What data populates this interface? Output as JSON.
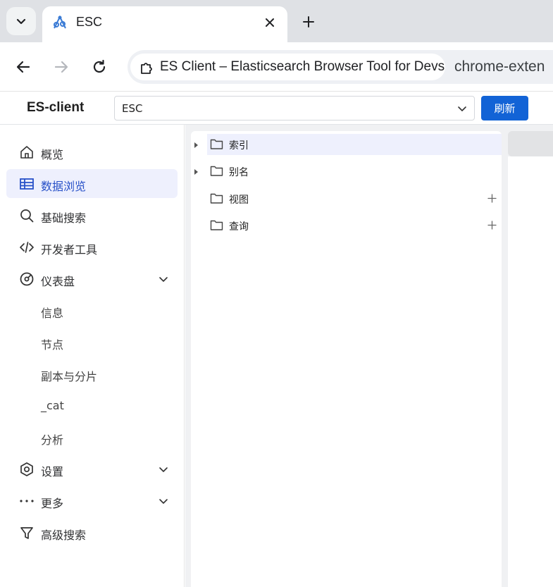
{
  "browser": {
    "tab": {
      "title": "ESC"
    },
    "omnibox": {
      "site_chip_text": "ES Client – Elasticsearch Browser Tool for Devs",
      "url_text": "chrome-exten"
    },
    "icons": {
      "tab_search": "chevron-down-icon",
      "favicon": "esc-logo-icon",
      "tab_close": "close-icon",
      "new_tab": "plus-icon",
      "back": "arrow-left-icon",
      "forward": "arrow-right-icon",
      "reload": "reload-icon",
      "extension": "puzzle-icon"
    }
  },
  "header": {
    "brand": "ES-client",
    "cluster_select": {
      "value": "ESC"
    },
    "refresh_label": "刷新",
    "accent_color": "#1263d6"
  },
  "sidebar": {
    "items": [
      {
        "label": "概览",
        "icon": "home-icon"
      },
      {
        "label": "数据浏览",
        "icon": "table-icon",
        "active": true
      },
      {
        "label": "基础搜索",
        "icon": "search-icon"
      },
      {
        "label": "开发者工具",
        "icon": "code-icon"
      },
      {
        "label": "仪表盘",
        "icon": "dashboard-icon",
        "expanded": true,
        "children": [
          {
            "label": "信息"
          },
          {
            "label": "节点"
          },
          {
            "label": "副本与分片"
          },
          {
            "label": "_cat"
          },
          {
            "label": "分析"
          }
        ]
      },
      {
        "label": "设置",
        "icon": "settings-hexagon-icon"
      },
      {
        "label": "更多",
        "icon": "more-dots-icon"
      },
      {
        "label": "高级搜索",
        "icon": "filter-icon"
      }
    ]
  },
  "tree": {
    "nodes": [
      {
        "label": "索引",
        "expandable": true,
        "selected": true
      },
      {
        "label": "别名",
        "expandable": true
      },
      {
        "label": "视图",
        "addable": true
      },
      {
        "label": "查询",
        "addable": true
      }
    ]
  }
}
